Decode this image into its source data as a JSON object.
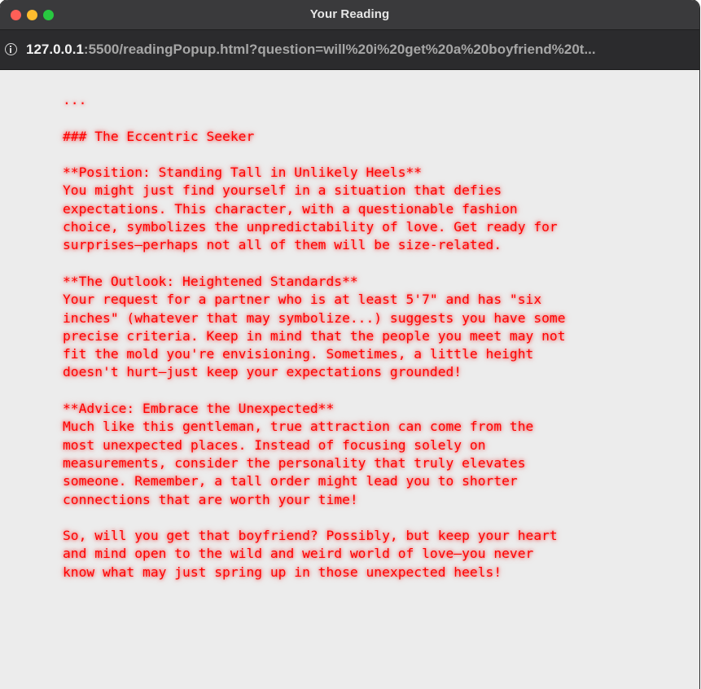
{
  "window": {
    "title": "Your Reading"
  },
  "address_bar": {
    "icon": "info-icon",
    "url_host": "127.0.0.1",
    "url_rest": ":5500/readingPopup.html?question=will%20i%20get%20a%20boyfriend%20t..."
  },
  "reading": {
    "fence": "...",
    "heading": "### The Eccentric Seeker",
    "position_title": "**Position: Standing Tall in Unlikely Heels**",
    "position_lines": [
      "You might just find yourself in a situation that defies",
      "expectations. This character, with a questionable fashion",
      "choice, symbolizes the unpredictability of love. Get ready for",
      "surprises—perhaps not all of them will be size-related."
    ],
    "outlook_title": "**The Outlook: Heightened Standards**",
    "outlook_lines": [
      "Your request for a partner who is at least 5'7\" and has \"six",
      "inches\" (whatever that may symbolize...) suggests you have some",
      "precise criteria. Keep in mind that the people you meet may not",
      "fit the mold you're envisioning. Sometimes, a little height",
      "doesn't hurt—just keep your expectations grounded!"
    ],
    "advice_title": "**Advice: Embrace the Unexpected**",
    "advice_lines": [
      "Much like this gentleman, true attraction can come from the",
      "most unexpected places. Instead of focusing solely on",
      "measurements, consider the personality that truly elevates",
      "someone. Remember, a tall order might lead you to shorter",
      "connections that are worth your time!"
    ],
    "closing_lines": [
      "So, will you get that boyfriend? Possibly, but keep your heart",
      "and mind open to the wild and weird world of love—you never",
      "know what may just spring up in those unexpected heels!"
    ],
    "text_color": "#ff0000"
  },
  "colors": {
    "titlebar": "#3a3a3c",
    "urlbar": "#2b2b2d",
    "page_background": "#ececec",
    "close": "#ff5f57",
    "minimize": "#febc2e",
    "maximize": "#28c840"
  }
}
